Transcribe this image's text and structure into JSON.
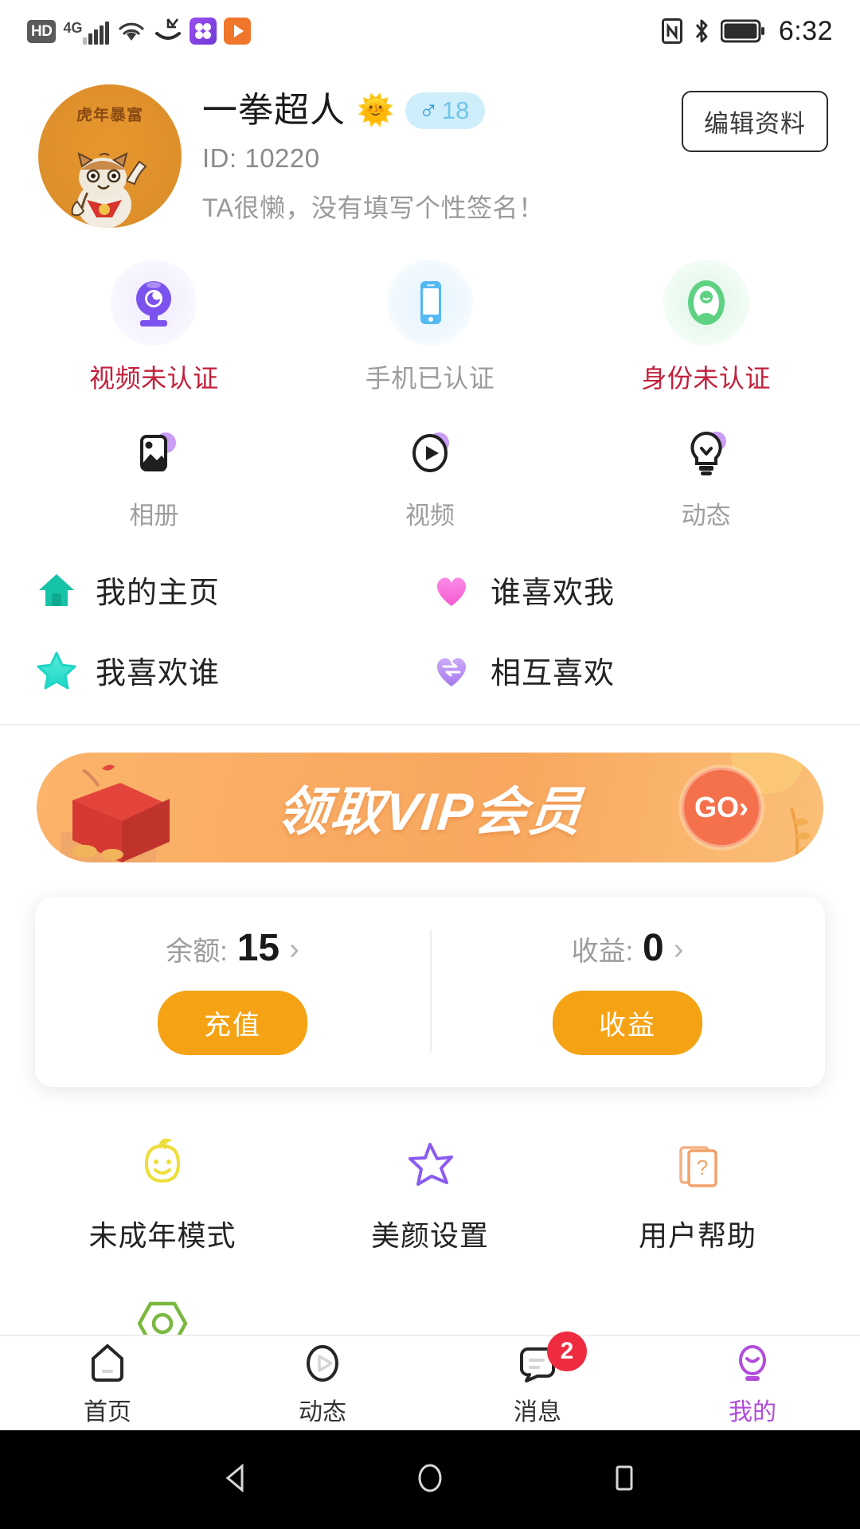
{
  "status_bar": {
    "hd_label": "HD",
    "network_label": "4G",
    "time": "6:32",
    "icons": [
      "hd-icon",
      "4g-signal-icon",
      "wifi-icon",
      "missed-call-icon",
      "app-purple-icon",
      "app-orange-icon",
      "nfc-icon",
      "bluetooth-icon",
      "battery-icon"
    ]
  },
  "profile": {
    "avatar_text": "虎年暴富",
    "username": "一拳超人",
    "username_emoji": "🌞",
    "gender_symbol": "♂",
    "age": "18",
    "id_text": "ID: 10220",
    "signature": "TA很懒，没有填写个性签名！",
    "edit_button": "编辑资料"
  },
  "verification": [
    {
      "label": "视频未认证",
      "icon": "webcam-icon",
      "state": "unverified"
    },
    {
      "label": "手机已认证",
      "icon": "phone-icon",
      "state": "verified"
    },
    {
      "label": "身份未认证",
      "icon": "identity-icon",
      "state": "unverified"
    }
  ],
  "media": [
    {
      "label": "相册",
      "icon": "album-icon"
    },
    {
      "label": "视频",
      "icon": "video-play-icon"
    },
    {
      "label": "动态",
      "icon": "lightbulb-icon"
    }
  ],
  "links": [
    {
      "label": "我的主页",
      "icon": "home-icon",
      "color": "#16c3a6"
    },
    {
      "label": "谁喜欢我",
      "icon": "heart-icon",
      "color": "#f96bd8"
    },
    {
      "label": "我喜欢谁",
      "icon": "star-icon",
      "color": "#2ae2d0"
    },
    {
      "label": "相互喜欢",
      "icon": "mutual-heart-icon",
      "color": "#b18cf0"
    }
  ],
  "vip_banner": {
    "text": "领取VIP会员",
    "go_label": "GO"
  },
  "wallet": {
    "balance_key": "余额:",
    "balance_value": "15",
    "balance_button": "充值",
    "income_key": "收益:",
    "income_value": "0",
    "income_button": "收益",
    "arrow": "›"
  },
  "tools": [
    {
      "label": "未成年模式",
      "icon": "baby-face-icon",
      "color": "#f0e13a"
    },
    {
      "label": "美颜设置",
      "icon": "beauty-star-icon",
      "color": "#8b5cf0"
    },
    {
      "label": "用户帮助",
      "icon": "help-cards-icon",
      "color": "#f4a26a"
    }
  ],
  "tools_row2": [
    {
      "label": "",
      "icon": "settings-hex-icon",
      "color": "#7ab83f"
    }
  ],
  "tabbar": [
    {
      "label": "首页",
      "icon": "home-tab-icon",
      "active": false,
      "badge": ""
    },
    {
      "label": "动态",
      "icon": "play-tab-icon",
      "active": false,
      "badge": ""
    },
    {
      "label": "消息",
      "icon": "message-tab-icon",
      "active": false,
      "badge": "2"
    },
    {
      "label": "我的",
      "icon": "profile-tab-icon",
      "active": true,
      "badge": ""
    }
  ],
  "android_nav": {
    "back": "back-triangle-icon",
    "home": "home-circle-icon",
    "recents": "recents-square-icon"
  },
  "colors": {
    "accent_purple": "#b24cdb",
    "orange_button": "#f5a314",
    "badge_red": "#ef2b40",
    "unverified_red": "#c2203c"
  }
}
